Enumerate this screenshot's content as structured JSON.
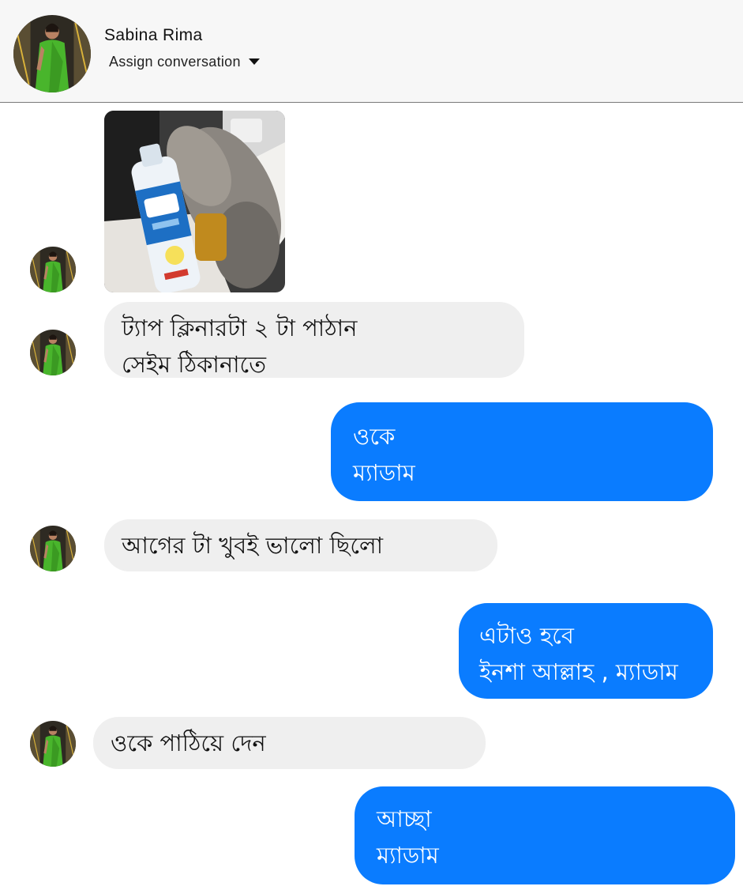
{
  "header": {
    "contact_name": "Sabina Rima",
    "assign_label": "Assign conversation"
  },
  "colors": {
    "outgoing_bubble": "#0a7cff",
    "incoming_bubble": "#efefef",
    "avatar_dress": "#49b52c"
  },
  "messages": [
    {
      "direction": "incoming",
      "type": "image",
      "alt": ""
    },
    {
      "direction": "incoming",
      "type": "text",
      "text": "ট্যাপ ক্লিনারটা ২ টা পাঠান\nসেইম ঠিকানাতে"
    },
    {
      "direction": "outgoing",
      "type": "text",
      "text": "ওকে\nম্যাডাম"
    },
    {
      "direction": "incoming",
      "type": "text",
      "text": "আগের টা খুবই ভালো ছিলো"
    },
    {
      "direction": "outgoing",
      "type": "text",
      "text": "এটাও হবে\nইনশা আল্লাহ , ম্যাডাম"
    },
    {
      "direction": "incoming",
      "type": "text",
      "text": "ওকে পাঠিয়ে দেন"
    },
    {
      "direction": "outgoing",
      "type": "text",
      "text": "আচ্ছা\nম্যাডাম"
    }
  ]
}
